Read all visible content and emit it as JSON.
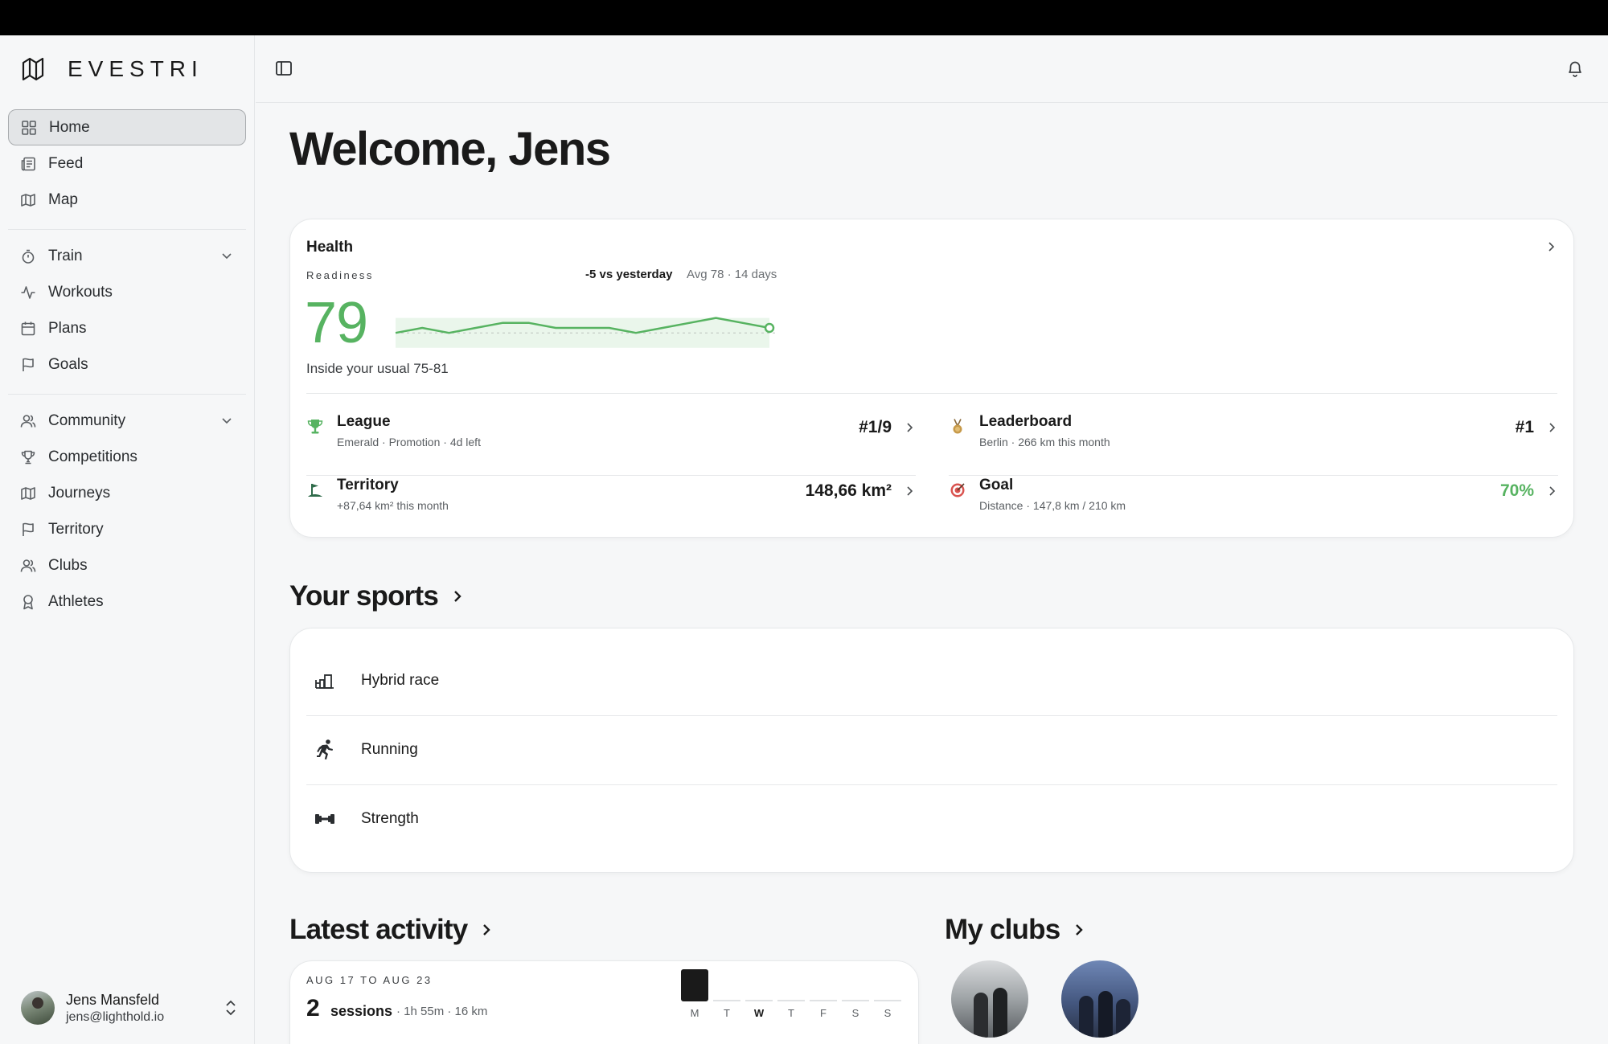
{
  "brand": {
    "name": "EVESTRI"
  },
  "sidebar": {
    "main": [
      {
        "label": "Home",
        "icon": "grid-icon",
        "active": true
      },
      {
        "label": "Feed",
        "icon": "newspaper-icon"
      },
      {
        "label": "Map",
        "icon": "map-icon"
      }
    ],
    "train": {
      "label": "Train",
      "items": [
        {
          "label": "Workouts",
          "icon": "activity-icon"
        },
        {
          "label": "Plans",
          "icon": "calendar-icon"
        },
        {
          "label": "Goals",
          "icon": "flag-icon"
        }
      ]
    },
    "community": {
      "label": "Community",
      "items": [
        {
          "label": "Competitions",
          "icon": "trophy-icon"
        },
        {
          "label": "Journeys",
          "icon": "map-icon"
        },
        {
          "label": "Territory",
          "icon": "flag-icon"
        },
        {
          "label": "Clubs",
          "icon": "users-icon"
        },
        {
          "label": "Athletes",
          "icon": "award-icon"
        }
      ]
    }
  },
  "user": {
    "name": "Jens Mansfeld",
    "email": "jens@lighthold.io"
  },
  "main": {
    "welcome": "Welcome, Jens",
    "health": {
      "title": "Health",
      "readiness_label": "Readiness",
      "delta": "-5 vs yesterday",
      "avg": "Avg 78 · 14 days",
      "score": "79",
      "usual": "Inside your usual 75-81",
      "accent": "#57b361",
      "sparkline": [
        78,
        79,
        78,
        79,
        80,
        80,
        79,
        79,
        79,
        78,
        79,
        80,
        81,
        80,
        79
      ],
      "stats": [
        {
          "name": "League",
          "sub": "Emerald · Promotion · 4d left",
          "value": "#1/9",
          "icon": "trophy-icon"
        },
        {
          "name": "Leaderboard",
          "sub": "Berlin · 266 km this month",
          "value": "#1",
          "icon": "medal-icon"
        },
        {
          "name": "Territory",
          "sub": "+87,64 km² this month",
          "value": "148,66 km²",
          "icon": "flag-icon"
        },
        {
          "name": "Goal",
          "sub": "Distance · 147,8 km / 210 km",
          "value": "70%",
          "icon": "target-icon"
        }
      ]
    },
    "sports": {
      "title": "Your sports",
      "items": [
        {
          "label": "Hybrid race",
          "icon": "hybrid-race-icon"
        },
        {
          "label": "Running",
          "icon": "running-icon"
        },
        {
          "label": "Strength",
          "icon": "dumbbell-icon"
        }
      ]
    },
    "activity": {
      "title": "Latest activity",
      "range": "AUG 17 TO AUG 23",
      "count": "2",
      "sessions_label": "sessions",
      "meta": "· 1h 55m · 16 km",
      "days": [
        "M",
        "T",
        "W",
        "T",
        "F",
        "S",
        "S"
      ],
      "today_index": 2,
      "active_days": [
        0
      ]
    },
    "clubs": {
      "title": "My clubs"
    }
  }
}
